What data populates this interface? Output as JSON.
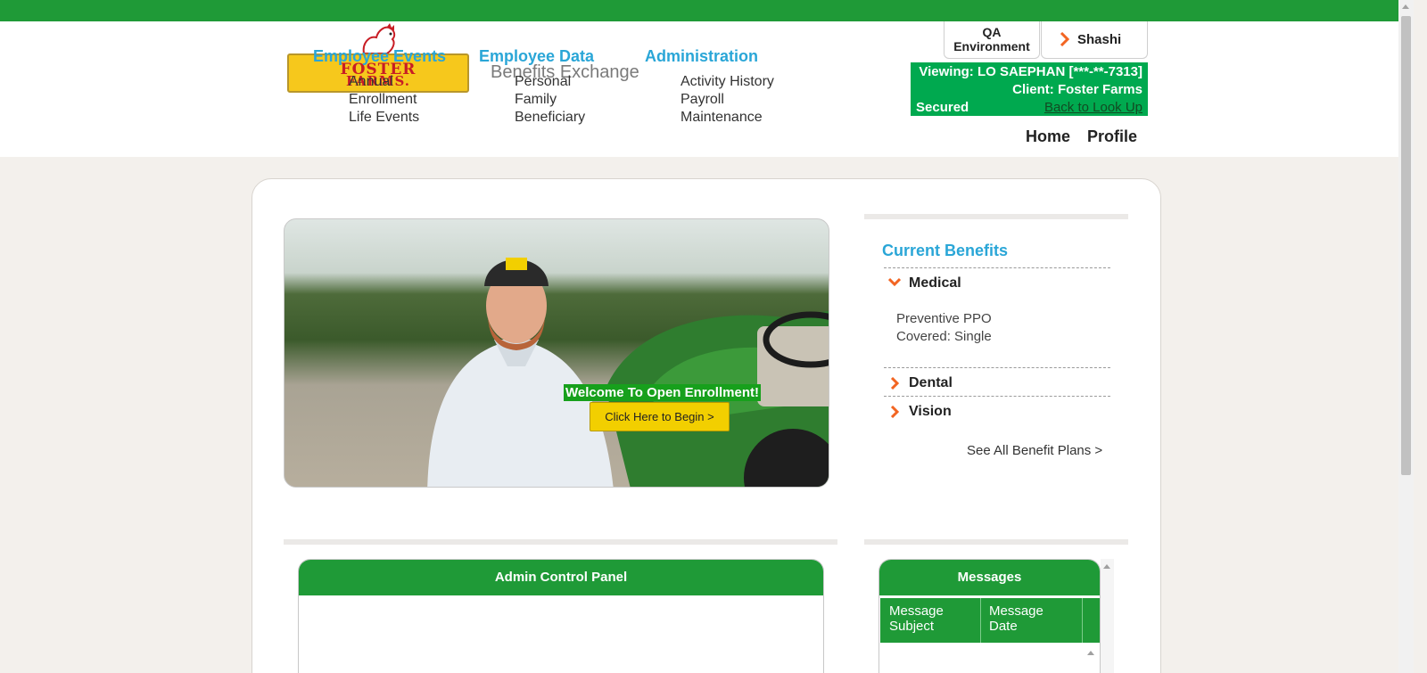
{
  "header": {
    "brand_logo_text_line1": "FOSTER",
    "brand_logo_text_line2": "FARMS.",
    "title": "Benefits Exchange",
    "environment_line1": "QA",
    "environment_line2": "Environment",
    "user_name": "Shashi",
    "viewing": "Viewing: LO SAEPHAN [***-**-7313]",
    "client": "Client: Foster Farms",
    "secured": "Secured",
    "back_link": "Back to Look Up",
    "nav": {
      "home": "Home",
      "profile": "Profile"
    }
  },
  "hero": {
    "welcome": "Welcome To Open Enrollment!",
    "begin_button": "Click Here to Begin >"
  },
  "current_benefits": {
    "title": "Current Benefits",
    "items": [
      {
        "label": "Medical",
        "expanded": true,
        "plan": "Preventive PPO",
        "coverage": "Covered: Single"
      },
      {
        "label": "Dental",
        "expanded": false
      },
      {
        "label": "Vision",
        "expanded": false
      }
    ],
    "see_all": "See All Benefit Plans >"
  },
  "admin_panel": {
    "title": "Admin Control Panel",
    "columns": [
      {
        "title": "Employee Events",
        "items": [
          "Annual",
          "Enrollment",
          "Life Events"
        ]
      },
      {
        "title": "Employee Data",
        "items": [
          "Personal",
          "Family",
          "Beneficiary"
        ]
      },
      {
        "title": "Administration",
        "items": [
          "Activity History",
          "Payroll",
          "Maintenance"
        ]
      }
    ]
  },
  "messages": {
    "title": "Messages",
    "col_subject_line1": "Message",
    "col_subject_line2": "Subject",
    "col_date_line1": "Message",
    "col_date_line2": "Date"
  },
  "colors": {
    "brand_green": "#1f9a37",
    "viewing_green": "#00a94f",
    "link_blue": "#2aa6d7",
    "cta_yellow": "#f2cf00",
    "chevron_orange": "#f26522"
  },
  "icons": {
    "user_chevron": "chevron-right-icon",
    "expanded": "chevron-down-icon",
    "collapsed": "chevron-right-icon"
  }
}
